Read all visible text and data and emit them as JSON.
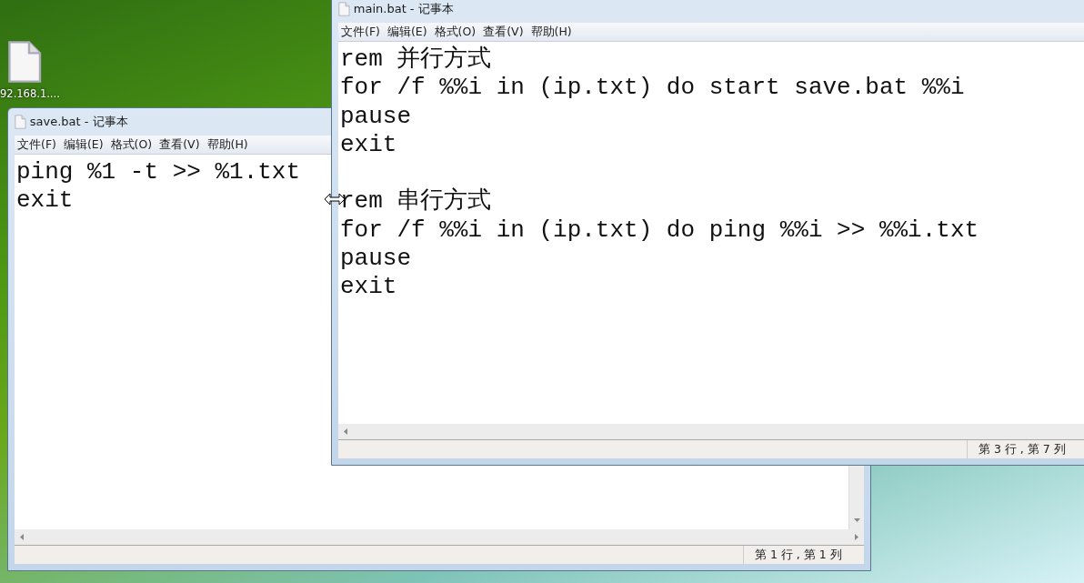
{
  "desktop": {
    "icons": [
      {
        "label": "92.168.1...."
      }
    ]
  },
  "windows": [
    {
      "title": "save.bat - 记事本",
      "menu": [
        "文件(F)",
        "编辑(E)",
        "格式(O)",
        "查看(V)",
        "帮助(H)"
      ],
      "blocks": [
        [
          "ping %1 -t >> %1.txt",
          "exit"
        ]
      ],
      "status": "第 1 行 , 第 1 列",
      "vertical_scrollbar": true
    },
    {
      "title": "main.bat - 记事本",
      "menu": [
        "文件(F)",
        "编辑(E)",
        "格式(O)",
        "查看(V)",
        "帮助(H)"
      ],
      "blocks": [
        [
          "rem 并行方式",
          "for /f %%i in (ip.txt) do start save.bat %%i",
          "pause",
          "exit"
        ],
        [
          "rem 串行方式",
          "for /f %%i in (ip.txt) do ping %%i >> %%i.txt",
          "pause",
          "exit"
        ]
      ],
      "status": "第 3 行 , 第 7 列",
      "vertical_scrollbar": false
    }
  ]
}
